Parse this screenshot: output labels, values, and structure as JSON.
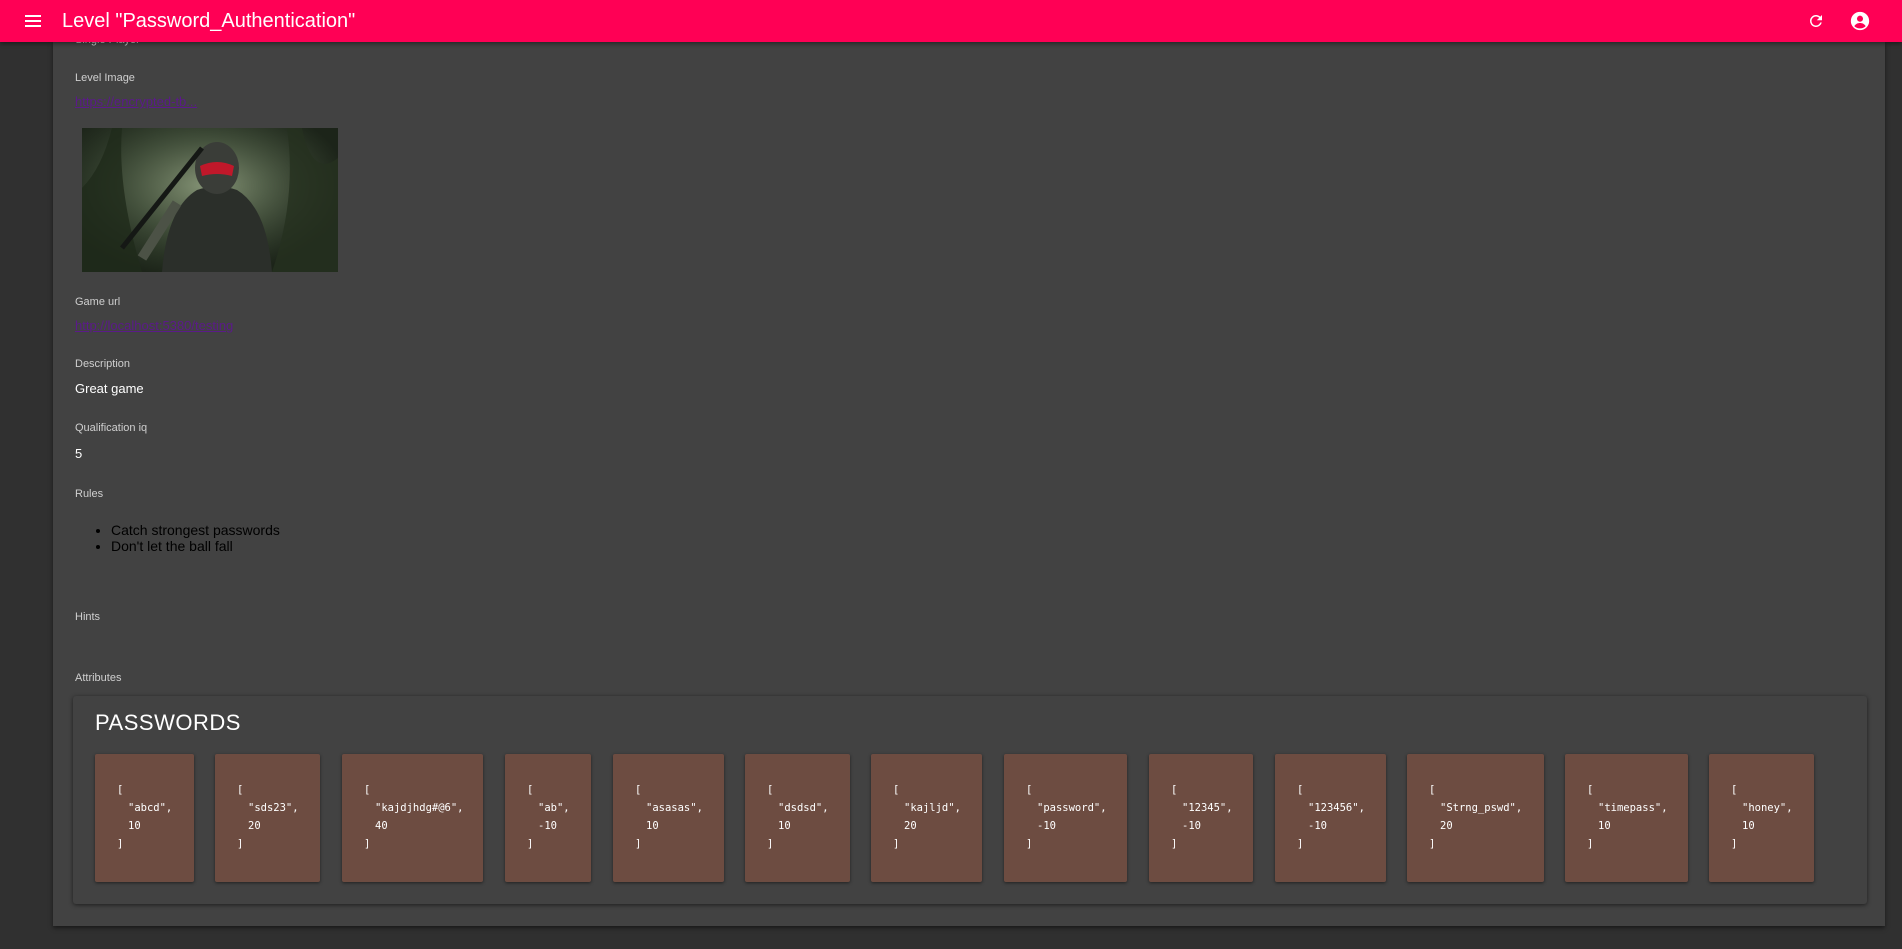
{
  "appbar": {
    "title": "Level \"Password_Authentication\"",
    "accent_color": "#ff0055",
    "icons": [
      "menu-icon",
      "refresh-icon",
      "account-circle-icon"
    ]
  },
  "details": {
    "mode_label": "Single Player",
    "level_image": {
      "label": "Level Image",
      "link": "https://encrypted-tb..."
    },
    "game_url": {
      "label": "Game url",
      "link": "http://localhost:5380/testing"
    },
    "description": {
      "label": "Description",
      "value": "Great game"
    },
    "qualification": {
      "label": "Qualification iq",
      "value": "5"
    },
    "rules": {
      "label": "Rules",
      "items": [
        "Catch strongest passwords",
        "Don't let the ball fall"
      ]
    },
    "hints": {
      "label": "Hints"
    },
    "attributes": {
      "label": "Attributes"
    }
  },
  "passwords": {
    "title": "PASSWORDS",
    "card_color": "#6d4c41",
    "open_bracket": "[",
    "close_bracket": "]",
    "items": [
      {
        "text": "\"abcd\",",
        "score": "10"
      },
      {
        "text": "\"sds23\",",
        "score": "20"
      },
      {
        "text": "\"kajdjhdg#@6\",",
        "score": "40"
      },
      {
        "text": "\"ab\",",
        "score": "-10"
      },
      {
        "text": "\"asasas\",",
        "score": "10"
      },
      {
        "text": "\"dsdsd\",",
        "score": "10"
      },
      {
        "text": "\"kajljd\",",
        "score": "20"
      },
      {
        "text": "\"password\",",
        "score": "-10"
      },
      {
        "text": "\"12345\",",
        "score": "-10"
      },
      {
        "text": "\"123456\",",
        "score": "-10"
      },
      {
        "text": "\"Strng_pswd\",",
        "score": "20"
      },
      {
        "text": "\"timepass\",",
        "score": "10"
      },
      {
        "text": "\"honey\",",
        "score": "10"
      }
    ]
  }
}
